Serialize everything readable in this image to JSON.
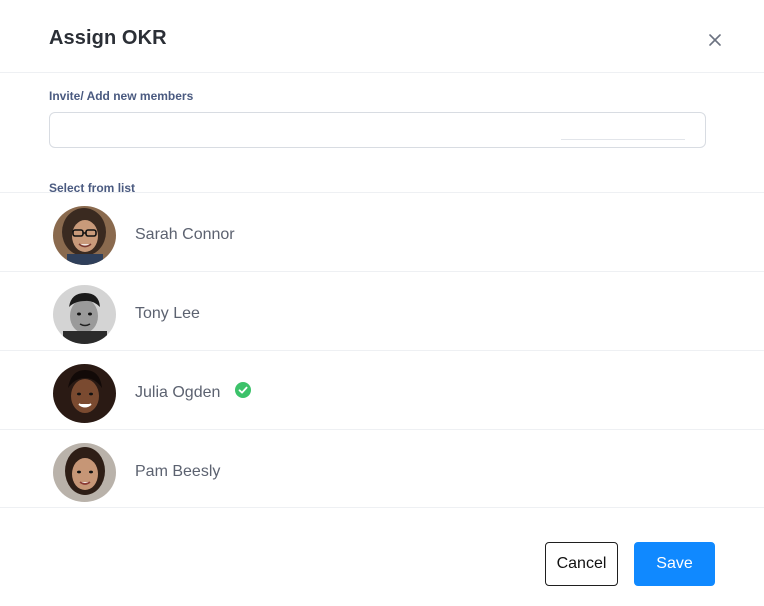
{
  "dialog": {
    "title": "Assign OKR",
    "close_icon": "close-icon"
  },
  "invite": {
    "label": "Invite/ Add new members",
    "value": "",
    "placeholder": ""
  },
  "list": {
    "label": "Select from list",
    "members": [
      {
        "name": "Sarah Connor",
        "selected": false,
        "avatar": "avatar-photo"
      },
      {
        "name": "Tony Lee",
        "selected": false,
        "avatar": "avatar-photo"
      },
      {
        "name": "Julia Ogden",
        "selected": true,
        "avatar": "avatar-photo",
        "check_icon": "check-circle-icon"
      },
      {
        "name": "Pam Beesly",
        "selected": false,
        "avatar": "avatar-photo"
      }
    ]
  },
  "actions": {
    "cancel_label": "Cancel",
    "save_label": "Save"
  },
  "colors": {
    "primary": "#1089ff",
    "check": "#3cc26a",
    "label": "#4a5a80",
    "title": "#2b2f36"
  }
}
